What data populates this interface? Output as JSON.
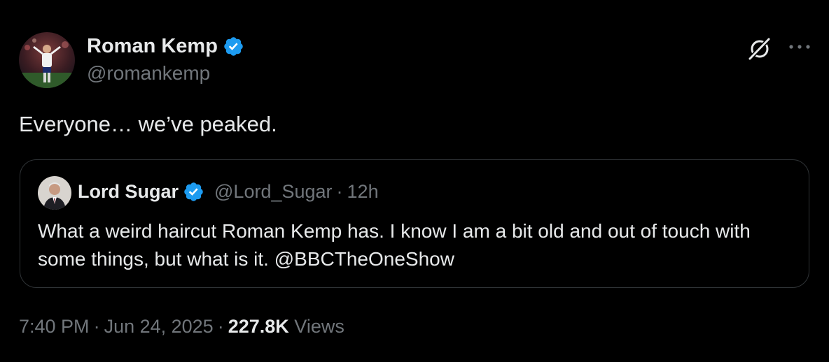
{
  "author": {
    "name": "Roman Kemp",
    "handle": "@romankemp"
  },
  "tweet": {
    "text": "Everyone… we’ve peaked."
  },
  "quoted": {
    "name": "Lord Sugar",
    "handle": "@Lord_Sugar",
    "dot": "·",
    "time": "12h",
    "text": "What a weird haircut Roman Kemp has. I know I am a bit old and out of touch with some things, but what is it.  ",
    "mention": "@BBCTheOneShow"
  },
  "meta": {
    "time": "7:40 PM",
    "sep1": "·",
    "date": "Jun 24, 2025",
    "sep2": "·",
    "views_count": "227.8K",
    "views_label": "Views"
  },
  "icons": {
    "verified": "verified-badge-icon",
    "grok": "grok-icon",
    "more": "more-horizontal-icon"
  },
  "colors": {
    "background": "#000000",
    "primary_text": "#e7e9ea",
    "secondary_text": "#71767b",
    "border": "#2f3336",
    "verified_blue": "#1d9bf0"
  }
}
